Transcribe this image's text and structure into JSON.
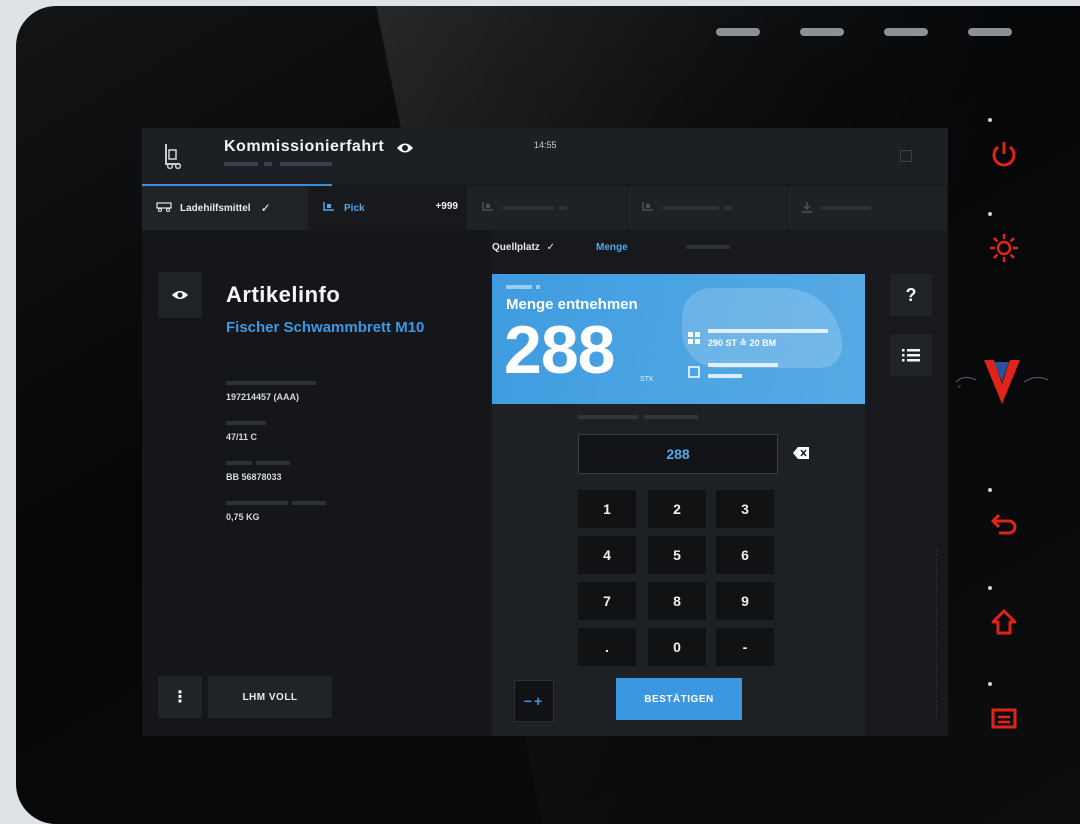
{
  "colors": {
    "accent_blue": "#3d98e2",
    "hardware_red": "#e2231a",
    "screen_bg": "#17191c"
  },
  "hardware": {
    "buttons": [
      {
        "name": "power-icon"
      },
      {
        "name": "brightness-icon"
      },
      {
        "name": "back-icon"
      },
      {
        "name": "home-icon"
      },
      {
        "name": "menu-icon"
      }
    ]
  },
  "header": {
    "title": "Kommissionierfahrt",
    "clock": "14:55"
  },
  "tabs": [
    {
      "label": "Ladehilfsmittel",
      "icon": "pallet-icon",
      "done": "✓"
    },
    {
      "label": "Pick",
      "icon": "forklift-icon",
      "badge": "+999"
    },
    {
      "label": "",
      "icon": "forklift-icon"
    },
    {
      "label": "",
      "icon": "forklift-icon"
    },
    {
      "label": "",
      "icon": "download-icon"
    }
  ],
  "article": {
    "heading": "Artikelinfo",
    "name": "Fischer Schwammbrett M10",
    "fields": [
      {
        "value": "197214457 (AAA)"
      },
      {
        "value": "47/11 C"
      },
      {
        "value": "BB 56878033"
      },
      {
        "value": "0,75 KG"
      }
    ]
  },
  "left_actions": {
    "more": "⋮",
    "lhm_full": "LHM VOLL"
  },
  "steps": [
    {
      "label": "Quellplatz",
      "done": "✓"
    },
    {
      "label": "Menge"
    }
  ],
  "task": {
    "heading": "Menge entnehmen",
    "quantity": "288",
    "unit": "STK",
    "packaging_value": "290 ST",
    "packaging_highlight": "≙ 20 BM"
  },
  "side_buttons": {
    "help": "?",
    "list": "list-icon"
  },
  "keypad": {
    "input_value": "288",
    "keys": [
      "1",
      "2",
      "3",
      "4",
      "5",
      "6",
      "7",
      "8",
      "9",
      ".",
      "0",
      "-"
    ],
    "plusminus": "−+",
    "confirm": "BESTÄTIGEN"
  }
}
